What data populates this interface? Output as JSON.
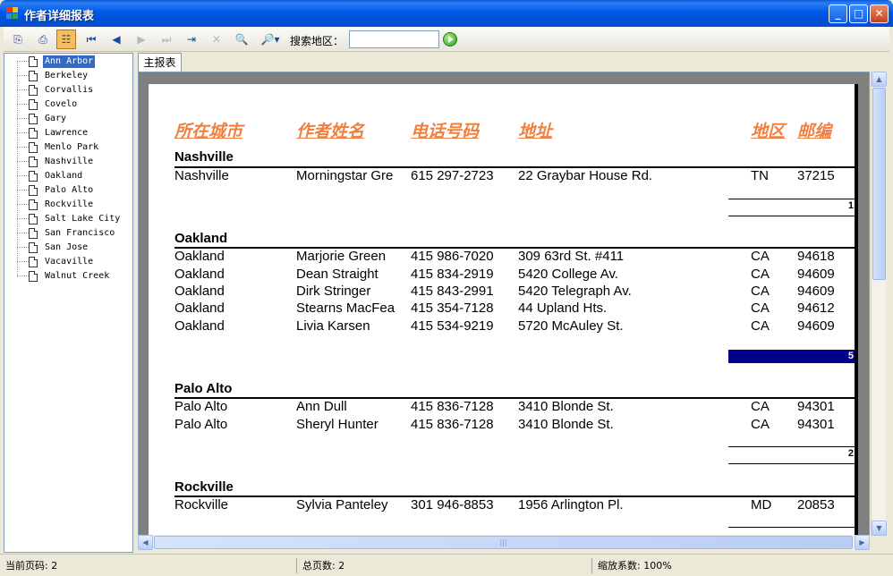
{
  "window": {
    "title": "作者详细报表",
    "buttons": {
      "minimize": "_",
      "maximize": "□",
      "close": "✕"
    }
  },
  "toolbar": {
    "buttons": [
      {
        "name": "export-icon",
        "glyph": "⎘",
        "active": false,
        "disabled": false
      },
      {
        "name": "print-icon",
        "glyph": "⎙",
        "active": false,
        "disabled": false
      },
      {
        "name": "group-tree-icon",
        "glyph": "☷",
        "active": true,
        "disabled": false
      },
      {
        "name": "first-page-icon",
        "glyph": "⏮",
        "active": false,
        "disabled": false
      },
      {
        "name": "previous-page-icon",
        "glyph": "◀",
        "active": false,
        "disabled": false
      },
      {
        "name": "next-page-icon",
        "glyph": "▶",
        "active": false,
        "disabled": true
      },
      {
        "name": "last-page-icon",
        "glyph": "⏭",
        "active": false,
        "disabled": true
      },
      {
        "name": "go-to-page-icon",
        "glyph": "⇥",
        "active": false,
        "disabled": false
      },
      {
        "name": "stop-icon",
        "glyph": "✕",
        "active": false,
        "disabled": true
      },
      {
        "name": "find-icon",
        "glyph": "🔍",
        "active": false,
        "disabled": false
      },
      {
        "name": "zoom-icon",
        "glyph": "🔎▾",
        "active": false,
        "disabled": false
      }
    ],
    "search_label": "搜索地区：",
    "search_value": "",
    "search_placeholder": ""
  },
  "tree": {
    "items": [
      "Ann Arbor",
      "Berkeley",
      "Corvallis",
      "Covelo",
      "Gary",
      "Lawrence",
      "Menlo Park",
      "Nashville",
      "Oakland",
      "Palo Alto",
      "Rockville",
      "Salt Lake City",
      "San Francisco",
      "San Jose",
      "Vacaville",
      "Walnut Creek"
    ],
    "selected_index": 0
  },
  "tabs": [
    {
      "label": "主报表"
    }
  ],
  "report": {
    "columns": {
      "city": "所在城市",
      "name": "作者姓名",
      "phone": "电话号码",
      "address": "地址",
      "state": "地区",
      "zip": "邮编"
    },
    "groups": [
      {
        "title": "Nashville",
        "rows": [
          {
            "city": "Nashville",
            "name": "Morningstar Gre",
            "phone": "615 297-2723",
            "address": "22 Graybar House Rd.",
            "state": "TN",
            "zip": "37215"
          }
        ],
        "count": "1",
        "highlight": false
      },
      {
        "title": "Oakland",
        "rows": [
          {
            "city": "Oakland",
            "name": "Marjorie Green",
            "phone": "415 986-7020",
            "address": "309 63rd St. #411",
            "state": "CA",
            "zip": "94618"
          },
          {
            "city": "Oakland",
            "name": "Dean Straight",
            "phone": "415 834-2919",
            "address": "5420 College Av.",
            "state": "CA",
            "zip": "94609"
          },
          {
            "city": "Oakland",
            "name": "Dirk Stringer",
            "phone": "415 843-2991",
            "address": "5420 Telegraph Av.",
            "state": "CA",
            "zip": "94609"
          },
          {
            "city": "Oakland",
            "name": "Stearns MacFea",
            "phone": "415 354-7128",
            "address": "44 Upland Hts.",
            "state": "CA",
            "zip": "94612"
          },
          {
            "city": "Oakland",
            "name": "Livia Karsen",
            "phone": "415 534-9219",
            "address": "5720 McAuley St.",
            "state": "CA",
            "zip": "94609"
          }
        ],
        "count": "5",
        "highlight": true
      },
      {
        "title": "Palo Alto",
        "rows": [
          {
            "city": "Palo Alto",
            "name": "Ann Dull",
            "phone": "415 836-7128",
            "address": "3410 Blonde St.",
            "state": "CA",
            "zip": "94301"
          },
          {
            "city": "Palo Alto",
            "name": "Sheryl Hunter",
            "phone": "415 836-7128",
            "address": "3410 Blonde St.",
            "state": "CA",
            "zip": "94301"
          }
        ],
        "count": "2",
        "highlight": false
      },
      {
        "title": "Rockville",
        "rows": [
          {
            "city": "Rockville",
            "name": "Sylvia Panteley",
            "phone": "301 946-8853",
            "address": "1956 Arlington Pl.",
            "state": "MD",
            "zip": "20853"
          }
        ],
        "count": "",
        "highlight": false
      }
    ]
  },
  "scrollbars": {
    "up": "▲",
    "down": "▼",
    "left": "◀",
    "right": "▶",
    "grip": "|||"
  },
  "status": {
    "current_page": "当前页码: 2",
    "total_pages": "总页数: 2",
    "zoom": "缩放系数: 100%"
  },
  "colors": {
    "title_bar": "#0058e6",
    "column_header": "#f08040",
    "highlight_total": "#00008b",
    "tree_selection": "#316ac5"
  }
}
